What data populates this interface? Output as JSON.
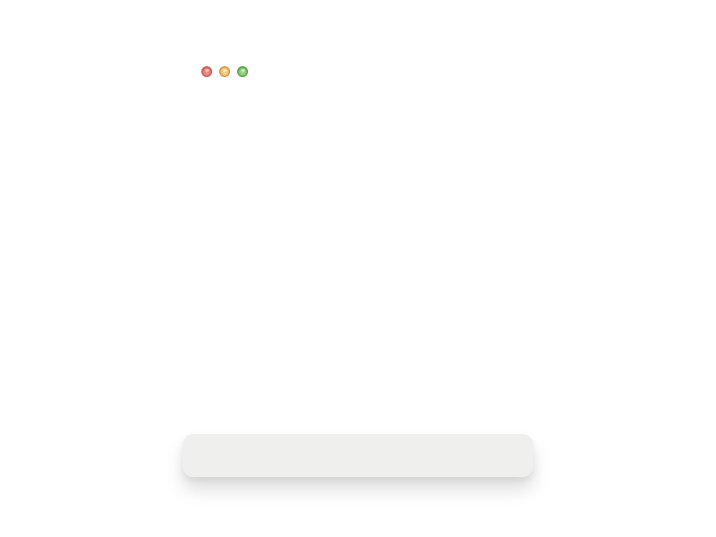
{
  "window": {
    "controls": [
      {
        "name": "close",
        "color": "#e06a64"
      },
      {
        "name": "minimize",
        "color": "#eeb65a"
      },
      {
        "name": "zoom",
        "color": "#6dbb5c"
      }
    ]
  },
  "bottom_panel": {
    "text": "",
    "background": "#efefee"
  }
}
